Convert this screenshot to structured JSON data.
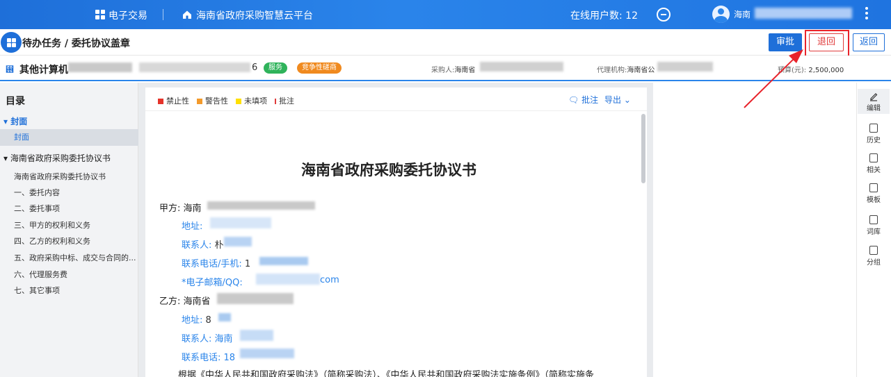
{
  "topbar": {
    "ecommerce": "电子交易",
    "platform": "海南省政府采购智慧云平台",
    "online_users": "在线用户数: 12",
    "user": "海南"
  },
  "titlebar": {
    "title": "待办任务 / 委托协议盖章",
    "approve": "审批",
    "return": "退回",
    "back": "返回"
  },
  "infobar": {
    "project_name": "其他计算机",
    "project_suffix": "6",
    "tag_service": "服务",
    "tag_method": "竞争性磋商",
    "buyer_label": "采购人:",
    "buyer_value": "海南省",
    "agent_label": "代理机构:",
    "agent_value": "海南省公",
    "budget_label": "预算(元):",
    "budget_value": "2,500,000"
  },
  "sidebar": {
    "title": "目录",
    "group1": "封面",
    "group1_item": "封面",
    "group2": "海南省政府采购委托协议书",
    "items": [
      "海南省政府采购委托协议书",
      "一、委托内容",
      "二、委托事项",
      "三、甲方的权利和义务",
      "四、乙方的权利和义务",
      "五、政府采购中标、成交与合同的...",
      "六、代理服务费",
      "七、其它事项"
    ]
  },
  "doc_toolbar": {
    "legend": [
      "禁止性",
      "警告性",
      "未填项",
      "批注"
    ],
    "legend_colors": [
      "#e5332a",
      "#f39a2b",
      "#ffe000",
      "#e03b3b"
    ],
    "annotate": "批注",
    "export": "导出"
  },
  "document": {
    "heading": "海南省政府采购委托协议书",
    "party_a_label": "甲方:",
    "party_a_value": "海南",
    "a_address": "地址:",
    "a_contact": "联系人:",
    "a_contact_value": "朴",
    "a_phone": "联系电话/手机:",
    "a_phone_value": "1",
    "a_email": "*电子邮箱/QQ:",
    "a_email_suffix": "com",
    "party_b_label": "乙方:",
    "party_b_value": "海南省",
    "b_address": "地址:",
    "b_address_value": "8",
    "b_contact": "联系人:",
    "b_contact_value": "海南",
    "b_phone": "联系电话:",
    "b_phone_value": "18",
    "body_start": "根据《中华人民共和国政府采购法》（简称采购法）、《中华人民共和国政府采购法实施条例》（简称实施条"
  },
  "right_toolbar": [
    "编辑",
    "历史",
    "相关",
    "模板",
    "词库",
    "分组"
  ]
}
